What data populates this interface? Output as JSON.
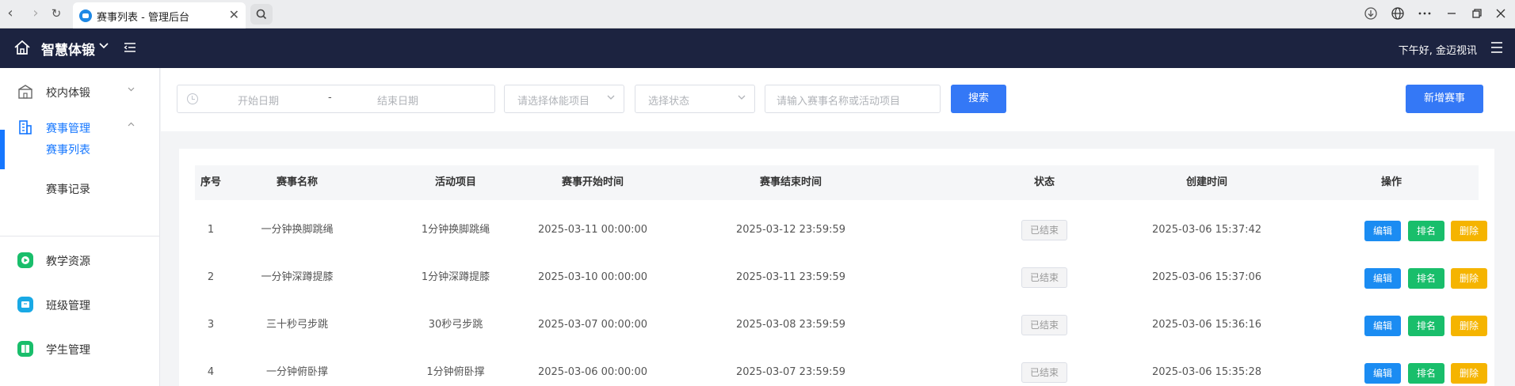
{
  "browser": {
    "tab_title": "赛事列表 - 管理后台",
    "close_glyph": "✕"
  },
  "header": {
    "brand": "智慧体锻",
    "greeting": "下午好, 金迈视讯"
  },
  "sidebar": {
    "items": [
      {
        "label": "校内体锻",
        "icon": "building-icon"
      },
      {
        "label": "赛事管理",
        "icon": "office-icon"
      },
      {
        "label": "赛事列表"
      },
      {
        "label": "赛事记录"
      },
      {
        "label": "教学资源",
        "icon": "video-icon"
      },
      {
        "label": "班级管理",
        "icon": "class-icon"
      },
      {
        "label": "学生管理",
        "icon": "student-icon"
      }
    ]
  },
  "filters": {
    "start_date_placeholder": "开始日期",
    "date_separator": "-",
    "end_date_placeholder": "结束日期",
    "project_placeholder": "请选择体能项目",
    "status_placeholder": "选择状态",
    "keyword_placeholder": "请输入赛事名称或活动项目",
    "search_label": "搜索",
    "add_label": "新增赛事"
  },
  "table": {
    "columns": [
      "序号",
      "赛事名称",
      "活动项目",
      "赛事开始时间",
      "赛事结束时间",
      "状态",
      "创建时间",
      "操作"
    ],
    "rows": [
      {
        "no": "1",
        "name": "一分钟换脚跳绳",
        "project": "1分钟换脚跳绳",
        "start": "2025-03-11 00:00:00",
        "end": "2025-03-12 23:59:59",
        "status": "已结束",
        "created": "2025-03-06 15:37:42"
      },
      {
        "no": "2",
        "name": "一分钟深蹲提膝",
        "project": "1分钟深蹲提膝",
        "start": "2025-03-10 00:00:00",
        "end": "2025-03-11 23:59:59",
        "status": "已结束",
        "created": "2025-03-06 15:37:06"
      },
      {
        "no": "3",
        "name": "三十秒弓步跳",
        "project": "30秒弓步跳",
        "start": "2025-03-07 00:00:00",
        "end": "2025-03-08 23:59:59",
        "status": "已结束",
        "created": "2025-03-06 15:36:16"
      },
      {
        "no": "4",
        "name": "一分钟俯卧撑",
        "project": "1分钟俯卧撑",
        "start": "2025-03-06 00:00:00",
        "end": "2025-03-07 23:59:59",
        "status": "已结束",
        "created": "2025-03-06 15:35:28"
      }
    ],
    "actions": {
      "edit": "编辑",
      "rank": "排名",
      "delete": "删除"
    }
  }
}
